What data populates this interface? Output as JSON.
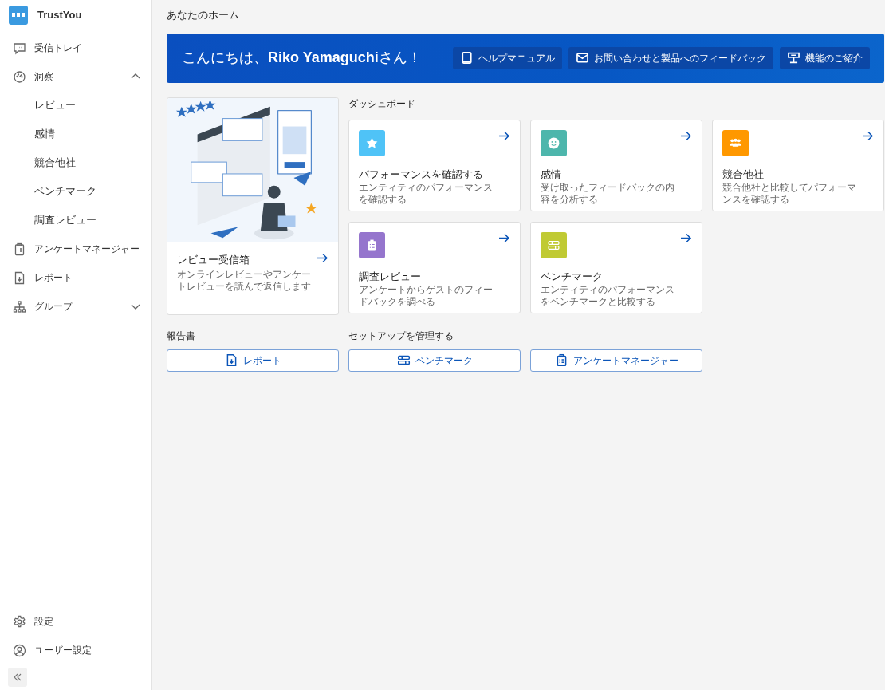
{
  "brand": {
    "name": "TrustYou"
  },
  "sidebar": {
    "items": [
      {
        "label": "受信トレイ",
        "kind": "link"
      },
      {
        "label": "洞察",
        "kind": "expandable",
        "expanded": true,
        "children": [
          {
            "label": "レビュー"
          },
          {
            "label": "感情"
          },
          {
            "label": "競合他社"
          },
          {
            "label": "ベンチマーク"
          },
          {
            "label": "調査レビュー"
          }
        ]
      },
      {
        "label": "アンケートマネージャー",
        "kind": "link"
      },
      {
        "label": "レポート",
        "kind": "link"
      },
      {
        "label": "グループ",
        "kind": "expandable",
        "expanded": false
      }
    ],
    "footer_items": [
      {
        "label": "設定"
      },
      {
        "label": "ユーザー設定"
      }
    ]
  },
  "page_title": "あなたのホーム",
  "banner": {
    "greeting": "こんにちは、**Riko Yamaguchi**さん！",
    "buttons": [
      "ヘルプマニュアル",
      "お問い合わせと製品へのフィードバック",
      "機能のご紹介"
    ]
  },
  "inbox_card": {
    "title": "レビュー受信箱",
    "description": "オンラインレビューやアンケートレビューを読んで返信します"
  },
  "dashboard": {
    "heading": "ダッシュボード",
    "cards": [
      {
        "title": "パフォーマンスを確認する",
        "description": "エンティティのパフォーマンスを確認する",
        "color": "#4fc3f7"
      },
      {
        "title": "感情",
        "description": "受け取ったフィードバックの内容を分析する",
        "color": "#4db6ac"
      },
      {
        "title": "競合他社",
        "description": "競合他社と比較してパフォーマンスを確認する",
        "color": "#ff9800"
      },
      {
        "title": "調査レビュー",
        "description": "アンケートからゲストのフィードバックを調べる",
        "color": "#9575cd"
      },
      {
        "title": "ベンチマーク",
        "description": "エンティティのパフォーマンスをベンチマークと比較する",
        "color": "#c0ca33"
      }
    ]
  },
  "reports": {
    "heading": "報告書",
    "buttons": [
      "レポート"
    ]
  },
  "setup": {
    "heading": "セットアップを管理する",
    "buttons": [
      "ベンチマーク",
      "アンケートマネージャー"
    ]
  }
}
